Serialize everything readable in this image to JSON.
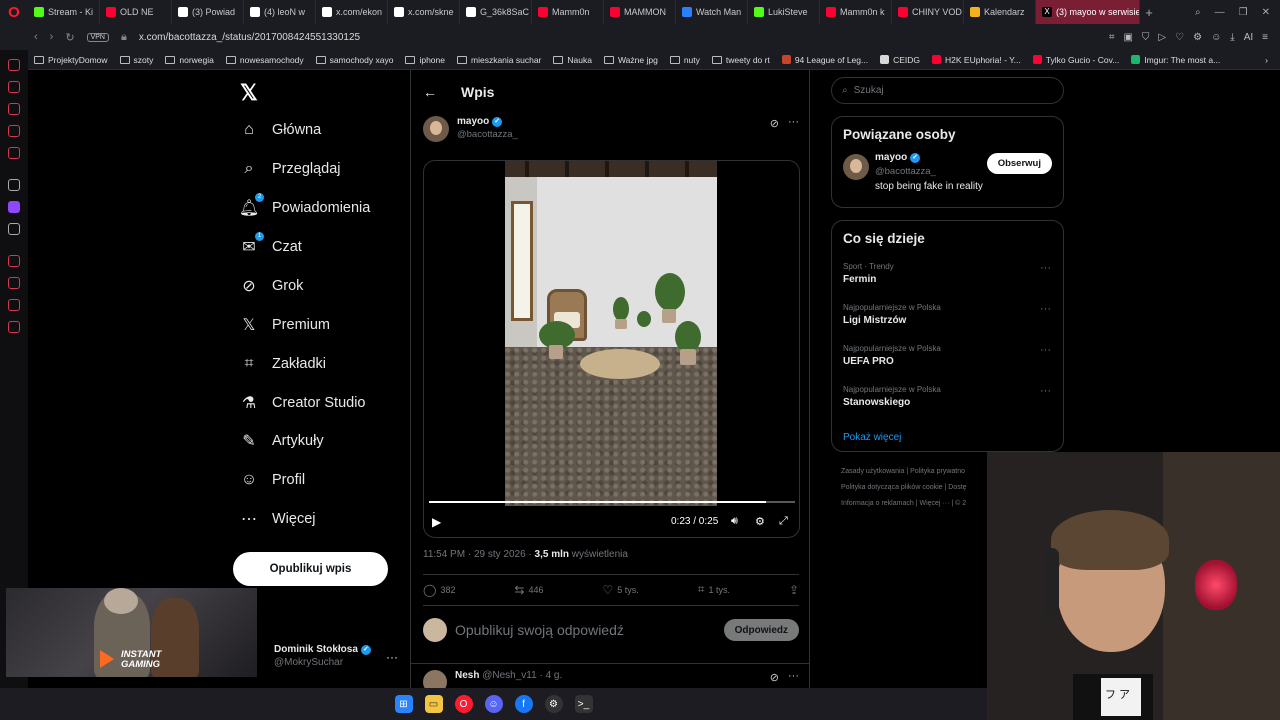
{
  "browser": {
    "tabs": [
      {
        "label": "Stream - Ki",
        "icon": "kick-icon",
        "color": "#53fc18"
      },
      {
        "label": "OLD NE",
        "icon": "youtube-icon",
        "color": "#ff0033"
      },
      {
        "label": "(3) Powiad",
        "icon": "x-icon",
        "color": "#ffffff"
      },
      {
        "label": "(4) leoN w",
        "icon": "x-icon",
        "color": "#ffffff"
      },
      {
        "label": "x.com/ekon",
        "icon": "x-icon",
        "color": "#ffffff"
      },
      {
        "label": "x.com/skne",
        "icon": "x-icon",
        "color": "#ffffff"
      },
      {
        "label": "G_36k8SaC",
        "icon": "x-icon",
        "color": "#ffffff"
      },
      {
        "label": "Mamm0n",
        "icon": "youtube-icon",
        "color": "#ff0033"
      },
      {
        "label": "MAMMON",
        "icon": "youtube-icon",
        "color": "#ff0033"
      },
      {
        "label": "Watch Man",
        "icon": "globe-icon",
        "color": "#2a7fff"
      },
      {
        "label": "LukiSteve",
        "icon": "kick-icon",
        "color": "#53fc18"
      },
      {
        "label": "Mamm0n k",
        "icon": "youtube-icon",
        "color": "#ff0033"
      },
      {
        "label": "CHINY VOD",
        "icon": "youtube-icon",
        "color": "#ff0033"
      },
      {
        "label": "Kalendarz",
        "icon": "calendar-icon",
        "color": "#f6b21a"
      }
    ],
    "active_tab": "(3) mayoo w serwisie",
    "vpn": "VPN",
    "url": "x.com/bacottazza_/status/2017008424551330125",
    "ai_label": "AI",
    "bookmarks": [
      {
        "label": "ProjektyDomow",
        "type": "folder"
      },
      {
        "label": "szoty",
        "type": "folder"
      },
      {
        "label": "norwegia",
        "type": "folder"
      },
      {
        "label": "nowesamochody",
        "type": "folder"
      },
      {
        "label": "samochody xayo",
        "type": "folder"
      },
      {
        "label": "iphone",
        "type": "folder"
      },
      {
        "label": "mieszkania suchar",
        "type": "folder"
      },
      {
        "label": "Nauka",
        "type": "folder"
      },
      {
        "label": "Ważne jpg",
        "type": "folder"
      },
      {
        "label": "nuty",
        "type": "folder"
      },
      {
        "label": "tweety do rt",
        "type": "folder"
      },
      {
        "label": "94 League of Leg...",
        "type": "site",
        "color": "#c8452b"
      },
      {
        "label": "CEIDG",
        "type": "site",
        "color": "#d8d8d8"
      },
      {
        "label": "H2K EUphoria! - Y...",
        "type": "site",
        "color": "#ff0033"
      },
      {
        "label": "Tylko Gucio - Cov...",
        "type": "site",
        "color": "#ff0033"
      },
      {
        "label": "Imgur: The most a...",
        "type": "site",
        "color": "#1bb76e"
      }
    ]
  },
  "nav": {
    "items": [
      {
        "label": "Główna",
        "icon": "home-icon",
        "glyph": "⌂"
      },
      {
        "label": "Przeglądaj",
        "icon": "search-icon",
        "glyph": "⌕"
      },
      {
        "label": "Powiadomienia",
        "icon": "bell-icon",
        "glyph": "🔔︎",
        "badge": "2"
      },
      {
        "label": "Czat",
        "icon": "mail-icon",
        "glyph": "✉",
        "badge": "1"
      },
      {
        "label": "Grok",
        "icon": "grok-icon",
        "glyph": "⊘"
      },
      {
        "label": "Premium",
        "icon": "x-premium-icon",
        "glyph": "𝕏"
      },
      {
        "label": "Zakładki",
        "icon": "bookmark-icon",
        "glyph": "⌗"
      },
      {
        "label": "Creator Studio",
        "icon": "flask-icon",
        "glyph": "⚗"
      },
      {
        "label": "Artykuły",
        "icon": "articles-icon",
        "glyph": "✎"
      },
      {
        "label": "Profil",
        "icon": "profile-icon",
        "glyph": "☺"
      },
      {
        "label": "Więcej",
        "icon": "more-icon",
        "glyph": "⋯"
      }
    ],
    "post_button": "Opublikuj wpis",
    "account": {
      "name": "Dominik Stokłosa",
      "handle": "@MokrySuchar"
    }
  },
  "post": {
    "header_title": "Wpis",
    "author_name": "mayoo",
    "author_handle": "@bacottazza_",
    "video": {
      "time": "0:23 / 0:25",
      "progress": 0.92
    },
    "timestamp": "11:54 PM · 29 sty 2026",
    "views_count": "3,5 mln",
    "views_label": "wyświetlenia",
    "replies": "382",
    "reposts": "446",
    "likes": "5 tys.",
    "bookmarks": "1 tys.",
    "reply_placeholder": "Opublikuj swoją odpowiedź",
    "reply_button": "Odpowiedz",
    "next_reply": {
      "name": "Nesh",
      "handle": "@Nesh_v11",
      "time": "· 4 g."
    }
  },
  "sidebar": {
    "search_placeholder": "Szukaj",
    "related_title": "Powiązane osoby",
    "related": {
      "name": "mayoo",
      "handle": "@bacottazza_",
      "bio": "stop being fake in reality",
      "follow": "Obserwuj"
    },
    "trends_title": "Co się dzieje",
    "trends": [
      {
        "context": "Sport · Trendy",
        "topic": "Fermin"
      },
      {
        "context": "Najpopularniejsze w Polska",
        "topic": "Ligi Mistrzów"
      },
      {
        "context": "Najpopularniejsze w Polska",
        "topic": "UEFA PRO"
      },
      {
        "context": "Najpopularniejsze w Polska",
        "topic": "Stanowskiego"
      }
    ],
    "show_more": "Pokaż więcej",
    "footer": [
      [
        "Zasady użytkowania",
        "Polityka prywatno"
      ],
      [
        "Polityka dotycząca plików cookie",
        "Dostę"
      ],
      [
        "Informacja o reklamach",
        "Więcej ···",
        "© 2"
      ]
    ]
  },
  "overlay": {
    "instant_gaming": "INSTANT\nGAMING",
    "shirt_glyphs": "フ ア"
  }
}
